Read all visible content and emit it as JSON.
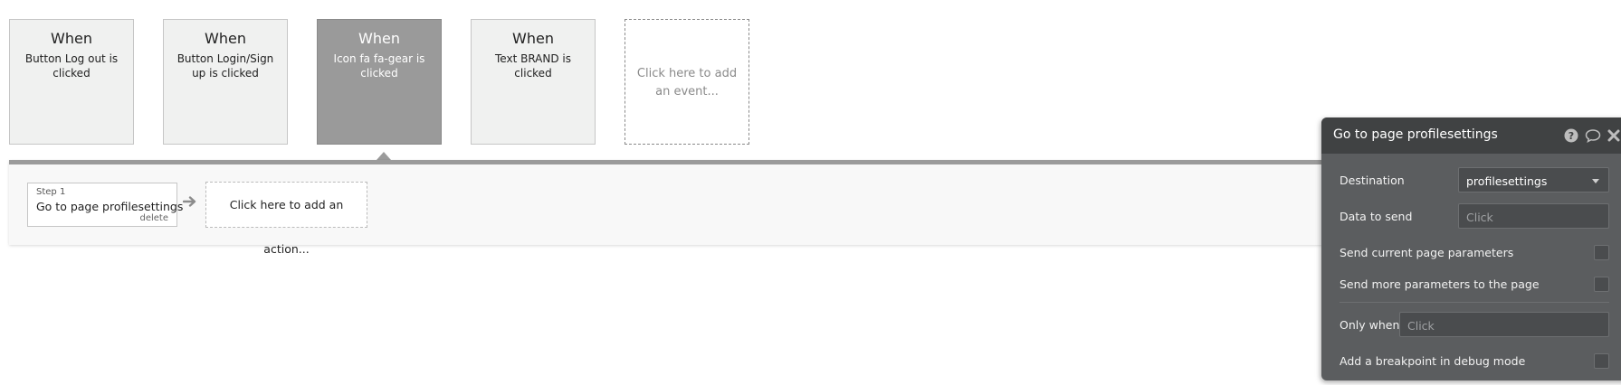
{
  "events": [
    {
      "when": "When",
      "desc": "Button Log out is clicked",
      "selected": false
    },
    {
      "when": "When",
      "desc": "Button Login/Sign up is clicked",
      "selected": false
    },
    {
      "when": "When",
      "desc": "Icon fa fa-gear is clicked",
      "selected": true
    },
    {
      "when": "When",
      "desc": "Text BRAND is clicked",
      "selected": false
    }
  ],
  "add_event": "Click here to add an event...",
  "actions": {
    "step_label": "Step 1",
    "step_title": "Go to page profilesettings",
    "delete_label": "delete",
    "add_action": "Click here to add an action..."
  },
  "panel": {
    "title": "Go to page profilesettings",
    "icons": [
      "help-icon",
      "comment-icon",
      "close-icon"
    ],
    "destination_label": "Destination",
    "destination_value": "profilesettings",
    "data_to_send_label": "Data to send",
    "data_to_send_placeholder": "Click",
    "send_current_params_label": "Send current page parameters",
    "send_more_params_label": "Send more parameters to the page",
    "only_when_label": "Only when",
    "only_when_placeholder": "Click",
    "breakpoint_label": "Add a breakpoint in debug mode"
  },
  "colors": {
    "selected_event": "#9a9a9a",
    "panel_bg": "#5b5d5f",
    "panel_header": "#404243"
  }
}
